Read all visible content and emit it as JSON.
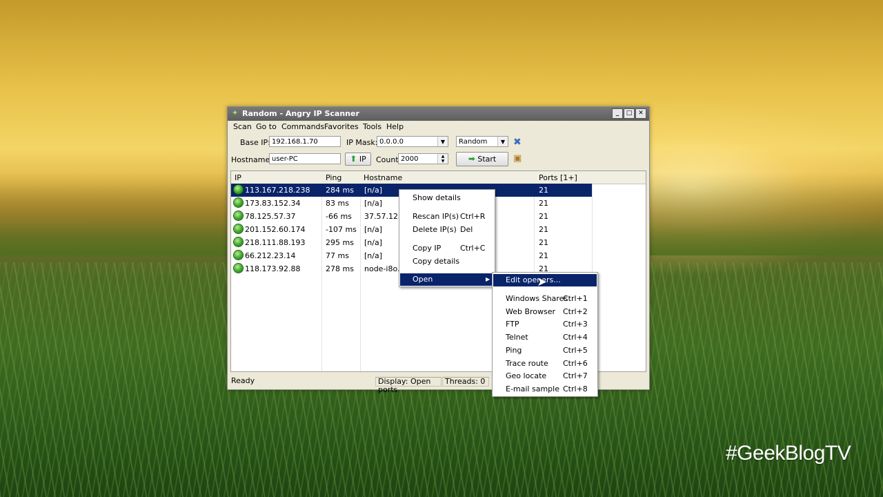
{
  "window": {
    "title": "Random - Angry IP Scanner",
    "buttons": [
      "_",
      "□",
      "✕"
    ]
  },
  "menubar": [
    "Scan",
    "Go to",
    "Commands",
    "Favorites",
    "Tools",
    "Help"
  ],
  "toolbar": {
    "base_ip_label": "Base IP:",
    "base_ip_value": "192.168.1.70",
    "ip_mask_label": "IP Mask:",
    "ip_mask_value": "0.0.0.0",
    "mode_value": "Random",
    "hostname_label": "Hostname:",
    "hostname_value": "user-PC",
    "ip_button": "IP",
    "count_label": "Count",
    "count_value": "2000",
    "start_button": "Start"
  },
  "table": {
    "columns": [
      "IP",
      "Ping",
      "Hostname",
      "Ports [1+]"
    ],
    "rows": [
      {
        "ip": "113.167.218.238",
        "ping": "284 ms",
        "hostname": "[n/a]",
        "ports": "21"
      },
      {
        "ip": "173.83.152.34",
        "ping": "83 ms",
        "hostname": "[n/a]",
        "ports": "21"
      },
      {
        "ip": "78.125.57.37",
        "ping": "-66 ms",
        "hostname": "37.57.125.7",
        "ports": "21"
      },
      {
        "ip": "201.152.60.174",
        "ping": "-107 ms",
        "hostname": "[n/a]",
        "ports": "21"
      },
      {
        "ip": "218.111.88.193",
        "ping": "295 ms",
        "hostname": "[n/a]",
        "ports": "21"
      },
      {
        "ip": "66.212.23.14",
        "ping": "77 ms",
        "hostname": "[n/a]",
        "ports": "21"
      },
      {
        "ip": "118.173.92.88",
        "ping": "278 ms",
        "hostname": "node-i8o.p",
        "ports": "21"
      }
    ]
  },
  "status": {
    "ready": "Ready",
    "display": "Display: Open ports",
    "threads": "Threads: 0"
  },
  "context_menu": {
    "items": [
      {
        "label": "Show details",
        "shortcut": ""
      },
      {
        "label": "Rescan IP(s)",
        "shortcut": "Ctrl+R"
      },
      {
        "label": "Delete IP(s)",
        "shortcut": "Del"
      },
      {
        "label": "Copy IP",
        "shortcut": "Ctrl+C"
      },
      {
        "label": "Copy details",
        "shortcut": ""
      },
      {
        "label": "Open",
        "shortcut": ""
      }
    ]
  },
  "submenu": {
    "items": [
      {
        "label": "Edit openers...",
        "shortcut": ""
      },
      {
        "label": "Windows Shares",
        "shortcut": "Ctrl+1"
      },
      {
        "label": "Web Browser",
        "shortcut": "Ctrl+2"
      },
      {
        "label": "FTP",
        "shortcut": "Ctrl+3"
      },
      {
        "label": "Telnet",
        "shortcut": "Ctrl+4"
      },
      {
        "label": "Ping",
        "shortcut": "Ctrl+5"
      },
      {
        "label": "Trace route",
        "shortcut": "Ctrl+6"
      },
      {
        "label": "Geo locate",
        "shortcut": "Ctrl+7"
      },
      {
        "label": "E-mail sample",
        "shortcut": "Ctrl+8"
      }
    ]
  },
  "watermark": "#GeekBlogTV",
  "colors": {
    "selection": "#0a246a",
    "status_green": "#3aa52a"
  }
}
